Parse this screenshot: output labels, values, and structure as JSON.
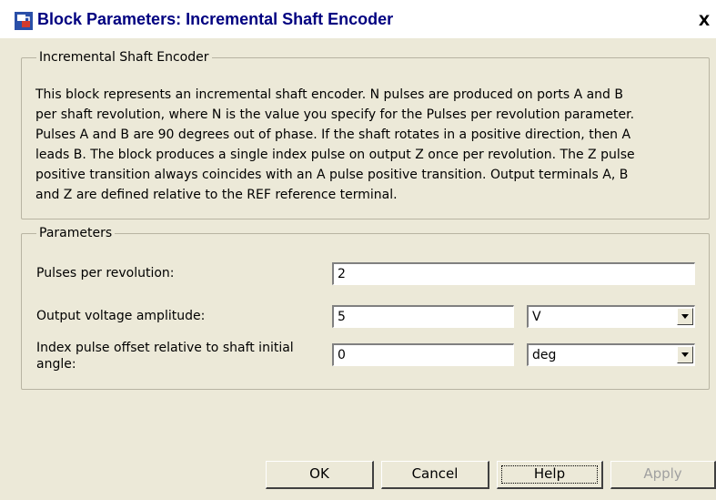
{
  "window": {
    "title": "Block Parameters: Incremental Shaft Encoder",
    "close_label": "X"
  },
  "description": {
    "group_title": "Incremental Shaft Encoder",
    "lines": [
      "This block represents an incremental shaft encoder. N pulses are produced on ports A and B",
      "per shaft revolution, where N is the value you specify for the Pulses per revolution parameter.",
      "Pulses A and B are 90 degrees out of phase. If the shaft rotates in a positive direction, then A",
      "leads B. The block produces a single index pulse on output Z once per revolution.  The Z pulse",
      "positive transition always coincides with an A pulse positive transition. Output terminals A, B",
      "and Z are defined relative to the REF reference terminal."
    ]
  },
  "parameters": {
    "group_title": "Parameters",
    "pulses": {
      "label": "Pulses per revolution:",
      "value": "2"
    },
    "amplitude": {
      "label": "Output voltage amplitude:",
      "value": "5",
      "unit": "V"
    },
    "offset": {
      "label_line1": "Index pulse offset relative to shaft initial",
      "label_line2": "angle:",
      "value": "0",
      "unit": "deg"
    }
  },
  "buttons": {
    "ok": "OK",
    "cancel": "Cancel",
    "help": "Help",
    "apply": "Apply"
  }
}
